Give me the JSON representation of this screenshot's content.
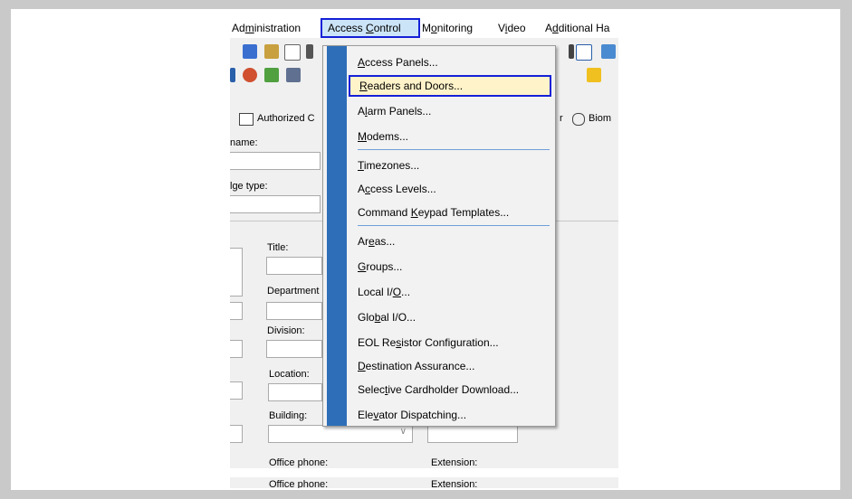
{
  "menubar": {
    "items": [
      {
        "pre": "Ad",
        "u": "m",
        "post": "inistration"
      },
      {
        "pre": "Access ",
        "u": "C",
        "post": "ontrol"
      },
      {
        "pre": "M",
        "u": "o",
        "post": "nitoring"
      },
      {
        "pre": "V",
        "u": "i",
        "post": "deo"
      },
      {
        "pre": "A",
        "u": "d",
        "post": "ditional Ha"
      }
    ]
  },
  "tabs": {
    "authorized": "Authorized C",
    "biometric": "Biom",
    "r_fragment": "r"
  },
  "form": {
    "last_name": "name:",
    "badge_type": "lge type:",
    "title": "Title:",
    "department": "Department",
    "division": "Division:",
    "location": "Location:",
    "building": "Building:",
    "office_phone": "Office phone:",
    "extension": "Extension:",
    "office_phone_2": "Office phone:",
    "extension_2": "Extension:"
  },
  "dropdown": {
    "items": [
      {
        "pre": "",
        "u": "A",
        "post": "ccess Panels..."
      },
      {
        "pre": "",
        "u": "R",
        "post": "eaders and Doors..."
      },
      {
        "pre": "A",
        "u": "l",
        "post": "arm Panels..."
      },
      {
        "pre": "",
        "u": "M",
        "post": "odems..."
      },
      {
        "pre": "",
        "u": "T",
        "post": "imezones..."
      },
      {
        "pre": "A",
        "u": "c",
        "post": "cess Levels..."
      },
      {
        "pre": "Command ",
        "u": "K",
        "post": "eypad Templates..."
      },
      {
        "pre": "Ar",
        "u": "e",
        "post": "as..."
      },
      {
        "pre": "",
        "u": "G",
        "post": "roups..."
      },
      {
        "pre": "Local I/",
        "u": "O",
        "post": "..."
      },
      {
        "pre": "Glo",
        "u": "b",
        "post": "al I/O..."
      },
      {
        "pre": "EOL Re",
        "u": "s",
        "post": "istor Configuration..."
      },
      {
        "pre": "",
        "u": "D",
        "post": "estination Assurance..."
      },
      {
        "pre": "Selec",
        "u": "t",
        "post": "ive Cardholder Download..."
      },
      {
        "pre": "Ele",
        "u": "v",
        "post": "ator Dispatching..."
      }
    ]
  }
}
